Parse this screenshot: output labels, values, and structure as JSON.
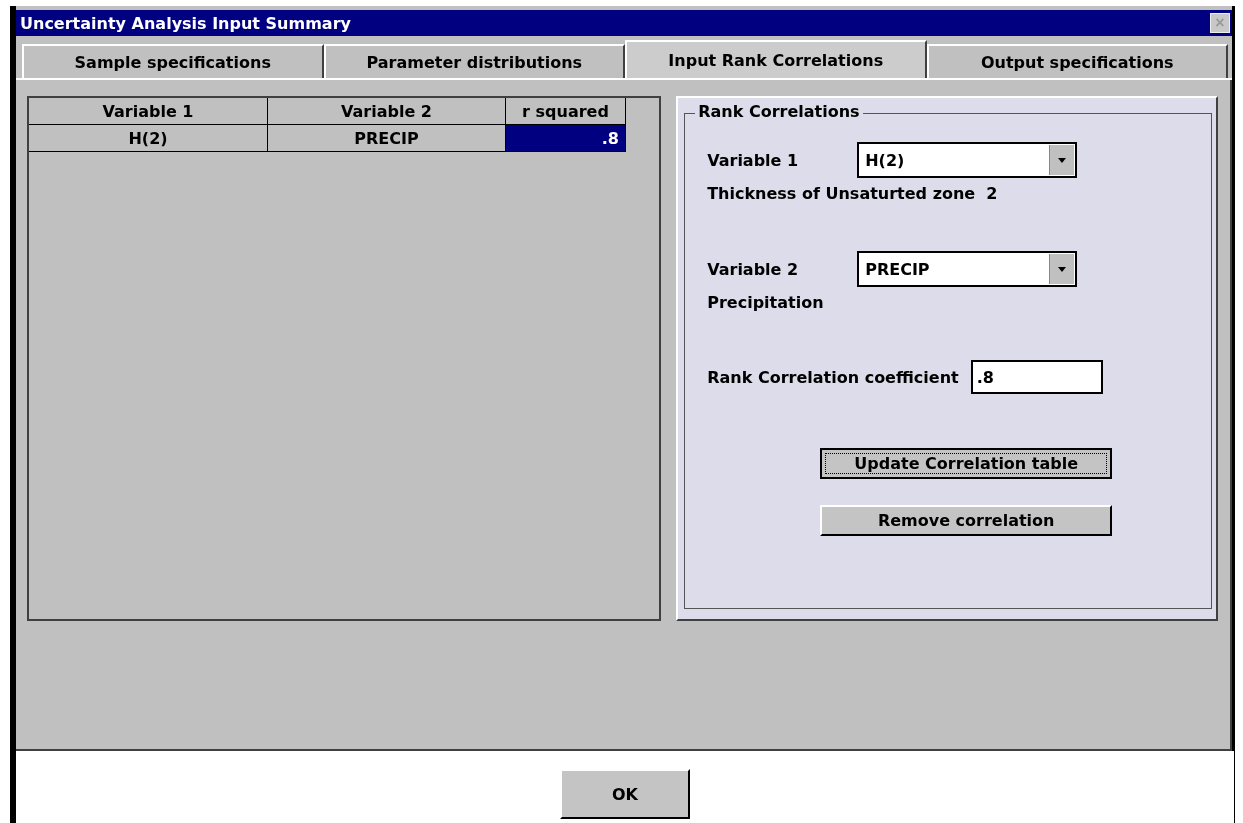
{
  "window": {
    "title": "Uncertainty Analysis Input Summary",
    "close": "×"
  },
  "tabs": [
    {
      "label": "Sample specifications",
      "selected": false
    },
    {
      "label": "Parameter distributions",
      "selected": false
    },
    {
      "label": "Input Rank Correlations",
      "selected": true
    },
    {
      "label": "Output specifications",
      "selected": false
    }
  ],
  "table": {
    "columns": [
      "Variable 1",
      "Variable 2",
      "r squared"
    ],
    "rows": [
      {
        "cells": [
          {
            "text": "H(2)",
            "selected": false
          },
          {
            "text": "PRECIP",
            "selected": false
          },
          {
            "text": ".8",
            "selected": true
          }
        ]
      }
    ]
  },
  "rank_correlations": {
    "title": "Rank Correlations",
    "variable_1": {
      "label": "Variable 1",
      "value": "H(2)",
      "description": "Thickness of Unsaturted zone  2"
    },
    "variable_2": {
      "label": "Variable 2",
      "value": "PRECIP",
      "description": "Precipitation"
    },
    "coefficient": {
      "label": "Rank Correlation coefficient",
      "value": ".8"
    },
    "buttons": [
      {
        "label": "Update Correlation table",
        "focused": true
      },
      {
        "label": "Remove correlation",
        "focused": false
      }
    ]
  },
  "ok_button": "OK"
}
